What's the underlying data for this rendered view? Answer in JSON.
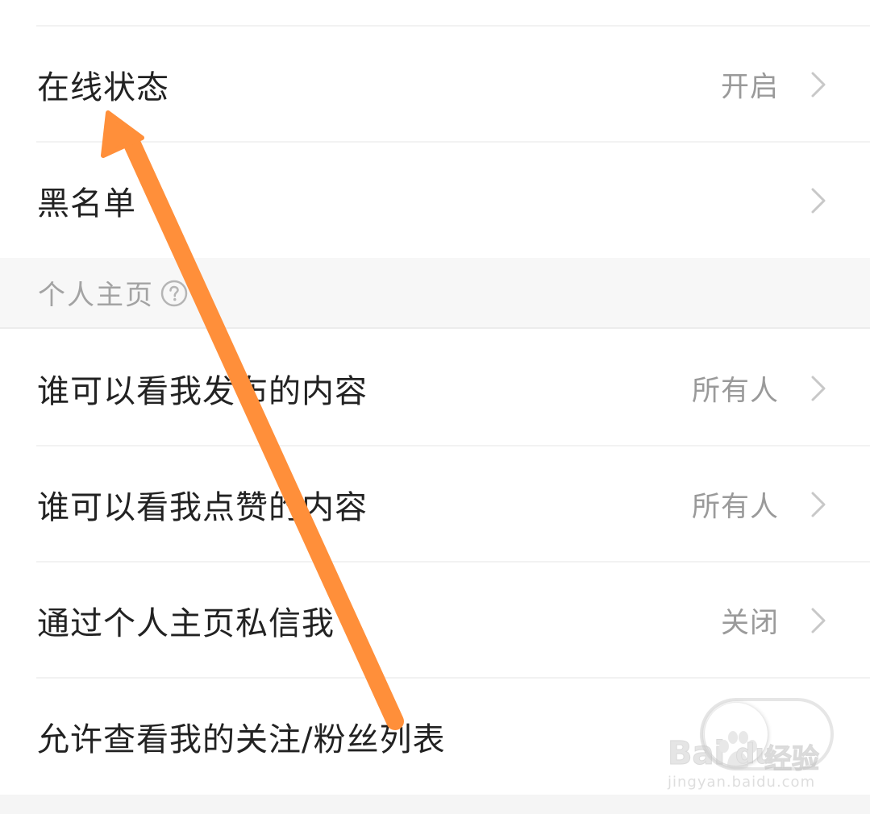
{
  "privacy_rows": [
    {
      "label": "在线状态",
      "value": "开启"
    },
    {
      "label": "黑名单",
      "value": ""
    }
  ],
  "section": {
    "title": "个人主页"
  },
  "homepage_rows": [
    {
      "label": "谁可以看我发布的内容",
      "value": "所有人"
    },
    {
      "label": "谁可以看我点赞的内容",
      "value": "所有人"
    },
    {
      "label": "通过个人主页私信我",
      "value": "关闭"
    }
  ],
  "toggle_row": {
    "label": "允许查看我的关注/粉丝列表",
    "enabled": false
  },
  "annotation": {
    "color": "#ff8f3a"
  },
  "watermark": {
    "brand_left": "Bai",
    "brand_mid": "du",
    "brand_right": "经验",
    "url": "jingyan.baidu.com"
  },
  "icons": {
    "chevron": "chevron-right-icon",
    "help": "question-circle-icon",
    "paw": "baidu-paw-icon"
  }
}
